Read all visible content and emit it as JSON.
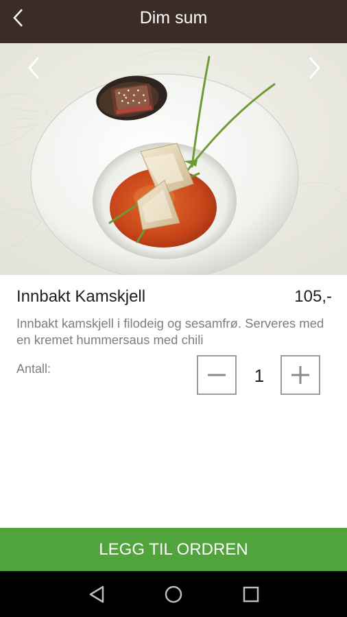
{
  "header": {
    "title": "Dim sum",
    "back_icon": "chevron-left-icon"
  },
  "gallery": {
    "prev_icon": "chevron-left-icon",
    "next_icon": "chevron-right-icon",
    "image_subject": "plated-dim-sum-photo"
  },
  "item": {
    "name": "Innbakt Kamskjell",
    "price": "105,-",
    "description": "Innbakt kamskjell i filodeig og sesamfrø. Serveres med en kremet hummersaus med chili"
  },
  "quantity": {
    "label": "Antall:",
    "value": "1",
    "decrement_icon": "minus-icon",
    "increment_icon": "plus-icon"
  },
  "add_button": {
    "label": "LEGG TIL ORDREN"
  },
  "system_nav": {
    "back_icon": "triangle-back-icon",
    "home_icon": "circle-home-icon",
    "recents_icon": "square-recents-icon"
  },
  "colors": {
    "header_bg": "#3b2d26",
    "accent_green": "#51a33c",
    "text_dark": "#1d1d1d",
    "text_muted": "#7d7d7d"
  }
}
